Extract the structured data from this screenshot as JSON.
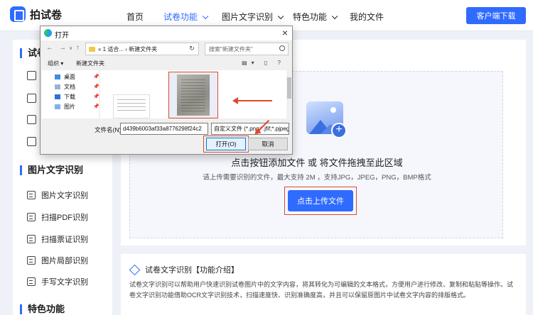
{
  "header": {
    "logo_text": "拍试卷",
    "nav": [
      {
        "label": "首页"
      },
      {
        "label": "试卷功能"
      },
      {
        "label": "图片文字识别"
      },
      {
        "label": "特色功能"
      },
      {
        "label": "我的文件"
      }
    ],
    "download_label": "客户端下载",
    "accent_color": "#2f6bff"
  },
  "sidebar": {
    "section1_title": "试卷",
    "section2_title": "图片文字识别",
    "items": [
      {
        "label": "图片文字识别",
        "icon": "image-scan-icon"
      },
      {
        "label": "扫描PDF识别",
        "icon": "pdf-scan-icon"
      },
      {
        "label": "扫描票证识别",
        "icon": "ticket-scan-icon"
      },
      {
        "label": "图片局部识别",
        "icon": "crop-scan-icon"
      },
      {
        "label": "手写文字识别",
        "icon": "handwriting-icon"
      }
    ],
    "section3_title": "特色功能"
  },
  "upload": {
    "main_text": "点击按钮添加文件 或 将文件拖拽至此区域",
    "sub_text": "请上传需要识别的文件，最大支持 2M ，支持JPG，JPEG，PNG，BMP格式",
    "button_label": "点击上传文件"
  },
  "intro": {
    "title": "试卷文字识别【功能介绍】",
    "body": "试卷文字识别可以帮助用户快速识别试卷图片中的文字内容，将其转化为可编辑的文本格式，方便用户进行修改、复制和粘贴等操作。试卷文字识别功能借助OCR文字识别技术，扫描速度快、识别准确度高，并且可以保留原图片中试卷文字内容的排版格式。"
  },
  "dialog": {
    "title": "打开",
    "path": "« 1 适合... › 新建文件夹",
    "search_placeholder": "搜索\"新建文件夹\"",
    "organize_label": "组织 ▾",
    "new_folder_label": "新建文件夹",
    "tree": [
      {
        "label": "桌面"
      },
      {
        "label": "文档"
      },
      {
        "label": "下载"
      },
      {
        "label": "图片"
      }
    ],
    "filename_label": "文件名(N):",
    "filename_value": "d439b6003af33a8776298f24c2",
    "filetype_value": "自定义文件 (*.png;*.jfif;*.pjpeg",
    "open_label": "打开(O)",
    "cancel_label": "取消"
  }
}
